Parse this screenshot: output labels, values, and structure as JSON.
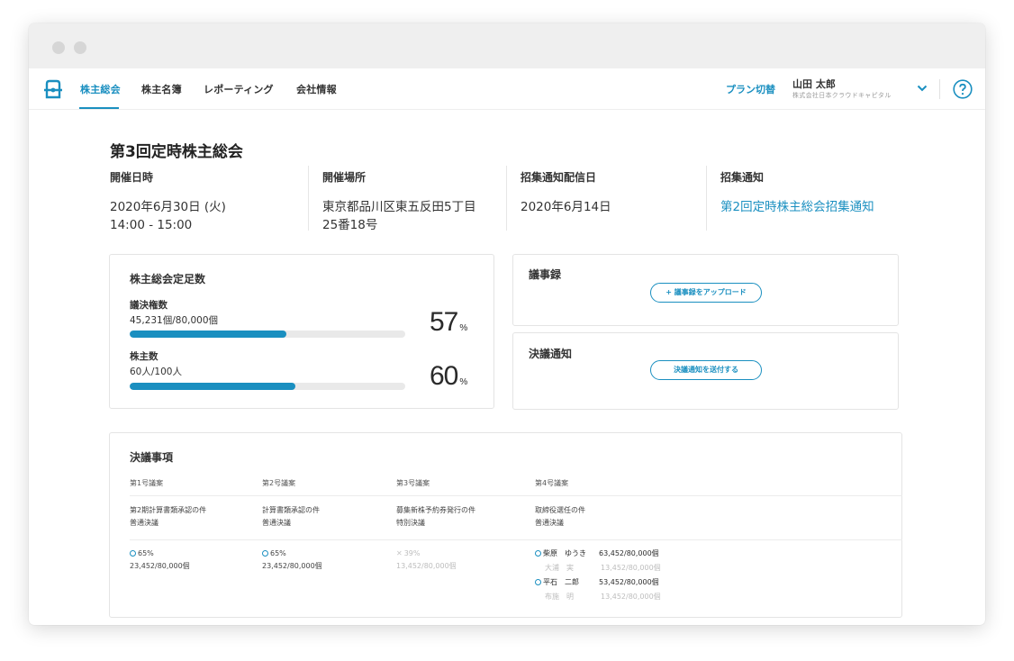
{
  "nav": {
    "items": [
      "株主総会",
      "株主名簿",
      "レポーティング",
      "会社情報"
    ],
    "plan_link": "プラン切替",
    "user_name": "山田 太郎",
    "user_company": "株式会社日本クラウドキャピタル"
  },
  "meeting": {
    "title": "第3回定時株主総会",
    "date_label": "開催日時",
    "date_line1": "2020年6月30日 (火)",
    "date_line2": "14:00 - 15:00",
    "venue_label": "開催場所",
    "venue_line1": "東京都品川区東五反田5丁目",
    "venue_line2": "25番18号",
    "notice_date_label": "招集通知配信日",
    "notice_date": "2020年6月14日",
    "notice_label": "招集通知",
    "notice_link": "第2回定時株主総会招集通知"
  },
  "quorum": {
    "title": "株主総会定足数",
    "rows": [
      {
        "label": "議決権数",
        "value": "45,231個/80,000個",
        "percent": 57,
        "unit": "%"
      },
      {
        "label": "株主数",
        "value": "60人/100人",
        "percent": 60,
        "unit": "%"
      }
    ]
  },
  "minutes": {
    "title": "議事録",
    "button": "+ 議事録をアップロード"
  },
  "resolution_notice": {
    "title": "決議通知",
    "button": "決議通知を送付する"
  },
  "resolutions": {
    "title": "決議事項",
    "headers": [
      "第1号議案",
      "第2号議案",
      "第3号議案",
      "第4号議案"
    ],
    "subjects": [
      {
        "name": "第2期計算書類承認の件",
        "type": "普通決議"
      },
      {
        "name": "計算書類承認の件",
        "type": "普通決議"
      },
      {
        "name": "募集新株予約券発行の件",
        "type": "特別決議"
      },
      {
        "name": "取締役選任の件",
        "type": "普通決議"
      }
    ],
    "results": [
      {
        "mark": "circle",
        "pct": "65%",
        "count": "23,452/80,000個"
      },
      {
        "mark": "circle",
        "pct": "65%",
        "count": "23,452/80,000個"
      },
      {
        "mark": "cross",
        "pct": "39%",
        "count": "13,452/80,000個"
      }
    ],
    "candidates": [
      {
        "mark": "circle",
        "name": "柴原　ゆうき",
        "count": "63,452/80,000個"
      },
      {
        "mark": "none",
        "name": "大浦　実",
        "count": "13,452/80,000個"
      },
      {
        "mark": "circle",
        "name": "平石　二郎",
        "count": "53,452/80,000個"
      },
      {
        "mark": "none",
        "name": "布施　明",
        "count": "13,452/80,000個"
      }
    ]
  },
  "colors": {
    "accent": "#1a8fc0"
  }
}
